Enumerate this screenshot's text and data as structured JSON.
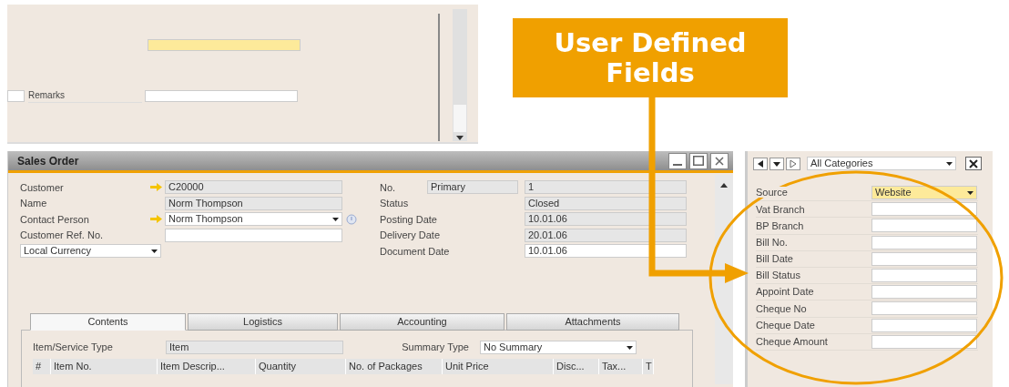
{
  "background_window": {
    "remarks_label": "Remarks"
  },
  "sales_order": {
    "title": "Sales Order",
    "header_left": [
      {
        "label": "Customer",
        "value": "C20000",
        "kind": "readonly",
        "link": true,
        "help": false
      },
      {
        "label": "Name",
        "value": "Norm Thompson",
        "kind": "readonly",
        "link": false,
        "help": false
      },
      {
        "label": "Contact Person",
        "value": "Norm Thompson",
        "kind": "dropdown",
        "link": true,
        "help": true
      },
      {
        "label": "Customer Ref. No.",
        "kind": "input",
        "link": false,
        "help": false
      }
    ],
    "currency": "Local Currency",
    "header_right": [
      {
        "label": "No.",
        "series": "Primary",
        "value": "1",
        "kind": "readonly"
      },
      {
        "label": "Status",
        "value": "Closed",
        "kind": "readonly"
      },
      {
        "label": "Posting Date",
        "value": "10.01.06",
        "kind": "readonly"
      },
      {
        "label": "Delivery Date",
        "value": "20.01.06",
        "kind": "readonly"
      },
      {
        "label": "Document Date",
        "value": "10.01.06",
        "kind": "input"
      }
    ],
    "tabs": [
      {
        "label": "Contents",
        "selected": true
      },
      {
        "label": "Logistics",
        "selected": false
      },
      {
        "label": "Accounting",
        "selected": false
      },
      {
        "label": "Attachments",
        "selected": false
      }
    ],
    "item_service_type": {
      "label": "Item/Service Type",
      "value": "Item"
    },
    "summary_type": {
      "label": "Summary Type",
      "value": "No Summary"
    },
    "table": {
      "columns": [
        "#",
        "Item No.",
        "Item Descrip...",
        "Quantity",
        "No. of Packages",
        "Unit Price",
        "Disc...",
        "Tax...",
        "T"
      ]
    }
  },
  "udf_panel": {
    "category": "All Categories",
    "fields": [
      {
        "label": "Source",
        "value": "Website",
        "kind": "dropdown"
      },
      {
        "label": "Vat Branch",
        "kind": "input"
      },
      {
        "label": "BP Branch",
        "kind": "input"
      },
      {
        "label": "Bill No.",
        "kind": "input"
      },
      {
        "label": "Bill Date",
        "kind": "input"
      },
      {
        "label": "Bill Status",
        "kind": "input"
      },
      {
        "label": "Appoint Date",
        "kind": "input"
      },
      {
        "label": "Cheque No",
        "kind": "input"
      },
      {
        "label": "Cheque Date",
        "kind": "input"
      },
      {
        "label": "Cheque Amount",
        "kind": "input"
      }
    ]
  },
  "callout": {
    "text": "User Defined Fields"
  }
}
